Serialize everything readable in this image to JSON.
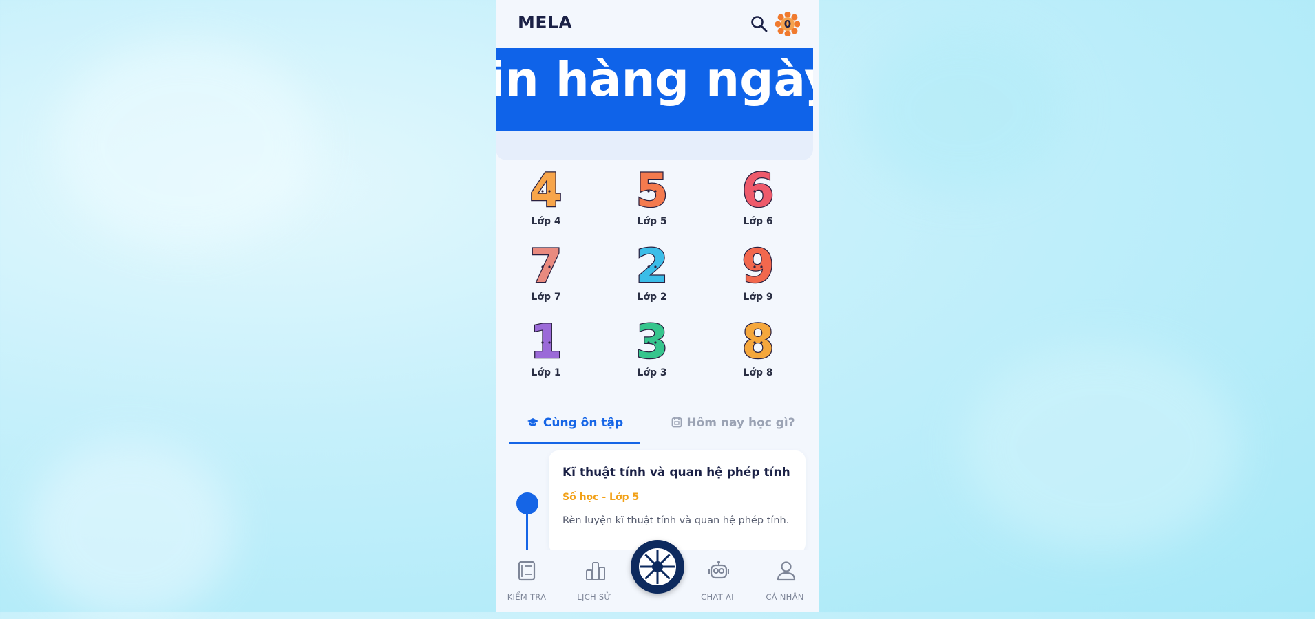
{
  "header": {
    "logo": "MELA",
    "coin_count": "0"
  },
  "banner": {
    "text": "in hàng ngày v"
  },
  "grades": [
    {
      "label": "Lớp 4",
      "digit": "4",
      "color": "#f7a54a"
    },
    {
      "label": "Lớp 5",
      "digit": "5",
      "color": "#f47a4e"
    },
    {
      "label": "Lớp 6",
      "digit": "6",
      "color": "#ee5a6b"
    },
    {
      "label": "Lớp 7",
      "digit": "7",
      "color": "#e98a7f"
    },
    {
      "label": "Lớp 2",
      "digit": "2",
      "color": "#3bbde8"
    },
    {
      "label": "Lớp 9",
      "digit": "9",
      "color": "#f2684e"
    },
    {
      "label": "Lớp 1",
      "digit": "1",
      "color": "#9b6ad8"
    },
    {
      "label": "Lớp 3",
      "digit": "3",
      "color": "#36c58d"
    },
    {
      "label": "Lớp 8",
      "digit": "8",
      "color": "#f5a73c"
    }
  ],
  "tabs": {
    "active": "Cùng ôn tập",
    "inactive": "Hôm nay học gì?"
  },
  "card": {
    "title": "Kĩ thuật tính và quan hệ phép tính",
    "subtitle": "Số học - Lớp 5",
    "description": "Rèn luyện kĩ thuật tính và quan hệ phép tính."
  },
  "nav": {
    "kiem_tra": "KIỂM TRA",
    "lich_su": "LỊCH SỬ",
    "chat_ai": "CHAT AI",
    "ca_nhan": "CÁ NHÂN"
  },
  "colors": {
    "primary": "#1565e6",
    "banner": "#0f63e9",
    "subtitle": "#f2a118",
    "center_button": "#0d2a5e"
  }
}
